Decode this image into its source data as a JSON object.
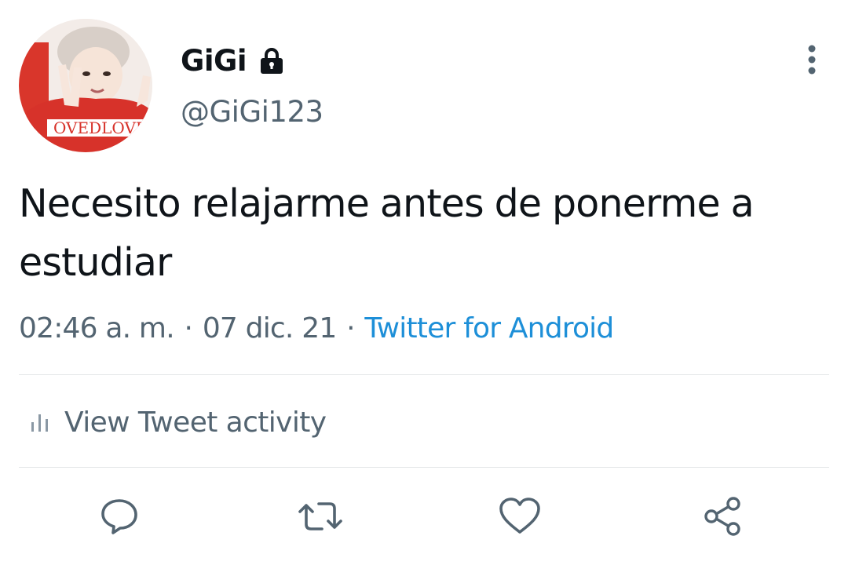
{
  "tweet": {
    "display_name": "GiGi",
    "handle": "@GiGi123",
    "text": "Necesito relajarme antes de ponerme a estudiar",
    "time": "02:46 a. m.",
    "separator": "·",
    "date": "07 dic. 21",
    "source": "Twitter for Android",
    "avatar_shirt_text": "OVEDLOVE"
  },
  "activity": {
    "label": "View Tweet activity",
    "icon": "bar-chart-icon"
  },
  "actions": [
    {
      "name": "reply",
      "icon": "speech-bubble-icon"
    },
    {
      "name": "retweet",
      "icon": "retweet-arrows-icon"
    },
    {
      "name": "like",
      "icon": "heart-icon"
    },
    {
      "name": "share",
      "icon": "share-nodes-icon"
    }
  ],
  "colors": {
    "primary_text": "#0f1419",
    "secondary_text": "#536471",
    "link": "#1d8fd8",
    "icon": "#536471",
    "divider": "#e3e6e8"
  }
}
